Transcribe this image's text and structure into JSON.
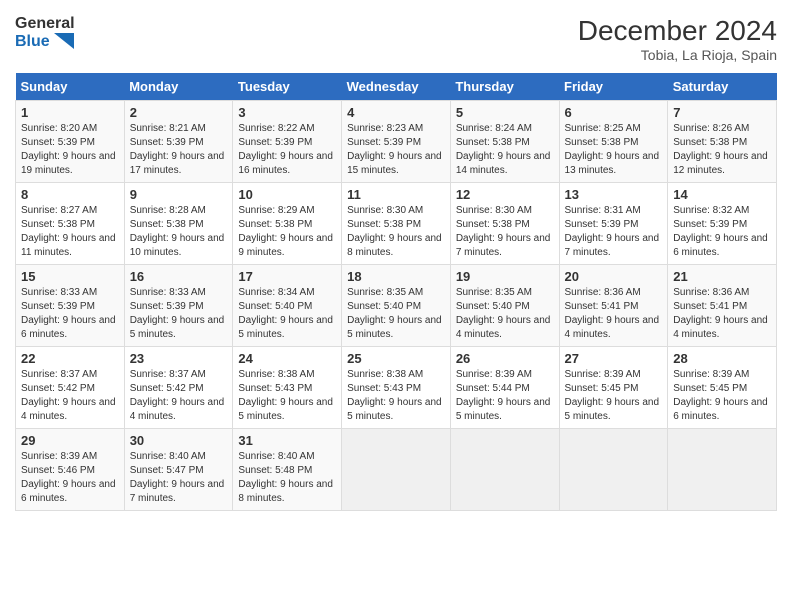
{
  "header": {
    "logo_line1": "General",
    "logo_line2": "Blue",
    "month": "December 2024",
    "location": "Tobia, La Rioja, Spain"
  },
  "days_of_week": [
    "Sunday",
    "Monday",
    "Tuesday",
    "Wednesday",
    "Thursday",
    "Friday",
    "Saturday"
  ],
  "weeks": [
    [
      {
        "day": "1",
        "info": "Sunrise: 8:20 AM\nSunset: 5:39 PM\nDaylight: 9 hours and 19 minutes."
      },
      {
        "day": "2",
        "info": "Sunrise: 8:21 AM\nSunset: 5:39 PM\nDaylight: 9 hours and 17 minutes."
      },
      {
        "day": "3",
        "info": "Sunrise: 8:22 AM\nSunset: 5:39 PM\nDaylight: 9 hours and 16 minutes."
      },
      {
        "day": "4",
        "info": "Sunrise: 8:23 AM\nSunset: 5:39 PM\nDaylight: 9 hours and 15 minutes."
      },
      {
        "day": "5",
        "info": "Sunrise: 8:24 AM\nSunset: 5:38 PM\nDaylight: 9 hours and 14 minutes."
      },
      {
        "day": "6",
        "info": "Sunrise: 8:25 AM\nSunset: 5:38 PM\nDaylight: 9 hours and 13 minutes."
      },
      {
        "day": "7",
        "info": "Sunrise: 8:26 AM\nSunset: 5:38 PM\nDaylight: 9 hours and 12 minutes."
      }
    ],
    [
      {
        "day": "8",
        "info": "Sunrise: 8:27 AM\nSunset: 5:38 PM\nDaylight: 9 hours and 11 minutes."
      },
      {
        "day": "9",
        "info": "Sunrise: 8:28 AM\nSunset: 5:38 PM\nDaylight: 9 hours and 10 minutes."
      },
      {
        "day": "10",
        "info": "Sunrise: 8:29 AM\nSunset: 5:38 PM\nDaylight: 9 hours and 9 minutes."
      },
      {
        "day": "11",
        "info": "Sunrise: 8:30 AM\nSunset: 5:38 PM\nDaylight: 9 hours and 8 minutes."
      },
      {
        "day": "12",
        "info": "Sunrise: 8:30 AM\nSunset: 5:38 PM\nDaylight: 9 hours and 7 minutes."
      },
      {
        "day": "13",
        "info": "Sunrise: 8:31 AM\nSunset: 5:39 PM\nDaylight: 9 hours and 7 minutes."
      },
      {
        "day": "14",
        "info": "Sunrise: 8:32 AM\nSunset: 5:39 PM\nDaylight: 9 hours and 6 minutes."
      }
    ],
    [
      {
        "day": "15",
        "info": "Sunrise: 8:33 AM\nSunset: 5:39 PM\nDaylight: 9 hours and 6 minutes."
      },
      {
        "day": "16",
        "info": "Sunrise: 8:33 AM\nSunset: 5:39 PM\nDaylight: 9 hours and 5 minutes."
      },
      {
        "day": "17",
        "info": "Sunrise: 8:34 AM\nSunset: 5:40 PM\nDaylight: 9 hours and 5 minutes."
      },
      {
        "day": "18",
        "info": "Sunrise: 8:35 AM\nSunset: 5:40 PM\nDaylight: 9 hours and 5 minutes."
      },
      {
        "day": "19",
        "info": "Sunrise: 8:35 AM\nSunset: 5:40 PM\nDaylight: 9 hours and 4 minutes."
      },
      {
        "day": "20",
        "info": "Sunrise: 8:36 AM\nSunset: 5:41 PM\nDaylight: 9 hours and 4 minutes."
      },
      {
        "day": "21",
        "info": "Sunrise: 8:36 AM\nSunset: 5:41 PM\nDaylight: 9 hours and 4 minutes."
      }
    ],
    [
      {
        "day": "22",
        "info": "Sunrise: 8:37 AM\nSunset: 5:42 PM\nDaylight: 9 hours and 4 minutes."
      },
      {
        "day": "23",
        "info": "Sunrise: 8:37 AM\nSunset: 5:42 PM\nDaylight: 9 hours and 4 minutes."
      },
      {
        "day": "24",
        "info": "Sunrise: 8:38 AM\nSunset: 5:43 PM\nDaylight: 9 hours and 5 minutes."
      },
      {
        "day": "25",
        "info": "Sunrise: 8:38 AM\nSunset: 5:43 PM\nDaylight: 9 hours and 5 minutes."
      },
      {
        "day": "26",
        "info": "Sunrise: 8:39 AM\nSunset: 5:44 PM\nDaylight: 9 hours and 5 minutes."
      },
      {
        "day": "27",
        "info": "Sunrise: 8:39 AM\nSunset: 5:45 PM\nDaylight: 9 hours and 5 minutes."
      },
      {
        "day": "28",
        "info": "Sunrise: 8:39 AM\nSunset: 5:45 PM\nDaylight: 9 hours and 6 minutes."
      }
    ],
    [
      {
        "day": "29",
        "info": "Sunrise: 8:39 AM\nSunset: 5:46 PM\nDaylight: 9 hours and 6 minutes."
      },
      {
        "day": "30",
        "info": "Sunrise: 8:40 AM\nSunset: 5:47 PM\nDaylight: 9 hours and 7 minutes."
      },
      {
        "day": "31",
        "info": "Sunrise: 8:40 AM\nSunset: 5:48 PM\nDaylight: 9 hours and 8 minutes."
      },
      {
        "day": "",
        "info": ""
      },
      {
        "day": "",
        "info": ""
      },
      {
        "day": "",
        "info": ""
      },
      {
        "day": "",
        "info": ""
      }
    ]
  ]
}
